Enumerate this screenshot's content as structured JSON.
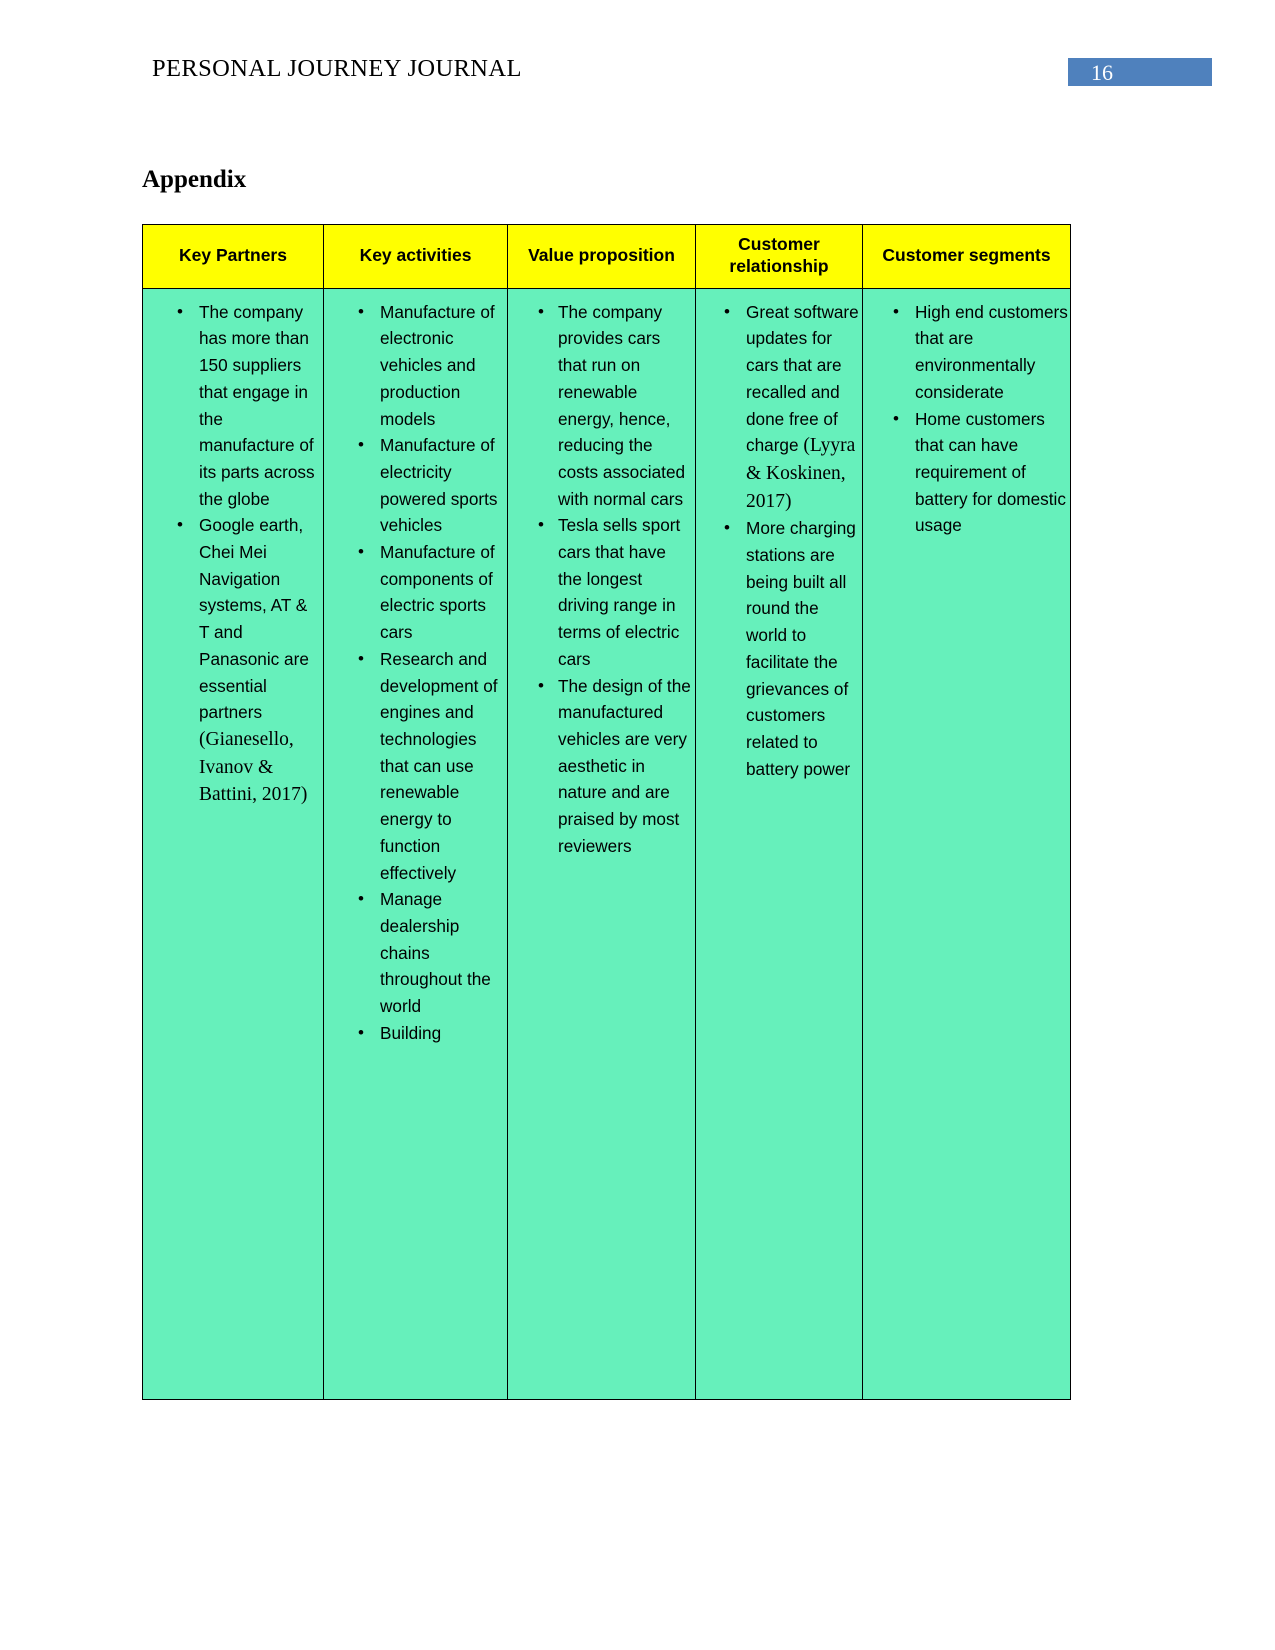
{
  "header": {
    "running_title": "PERSONAL JOURNEY JOURNAL",
    "page_number": "16",
    "badge_color": "#4f81bd"
  },
  "document": {
    "section_heading": "Appendix"
  },
  "table": {
    "header_background": "#ffff00",
    "cell_background": "#66f0bb",
    "columns": [
      {
        "id": "key-partners",
        "label": "Key Partners"
      },
      {
        "id": "key-activities",
        "label": "Key activities"
      },
      {
        "id": "value-proposition",
        "label": "Value proposition"
      },
      {
        "id": "customer-relationship",
        "label": "Customer relationship"
      },
      {
        "id": "customer-segments",
        "label": "Customer segments"
      }
    ],
    "cells": {
      "key_partners": {
        "item_0": "The company has more than 150 suppliers that engage in the manufacture of its parts across the globe",
        "item_1_main": "Google earth, Chei Mei Navigation systems, AT & T and Panasonic are essential partners ",
        "item_1_citation": "(Gianesello, Ivanov & Battini, 2017)"
      },
      "key_activities": {
        "item_0": "Manufacture of electronic vehicles and production models",
        "item_1": "Manufacture of electricity powered sports vehicles",
        "item_2": "Manufacture of components of electric sports cars",
        "item_3": "Research and development of engines and technologies that can use renewable energy to function effectively",
        "item_4": "Manage dealership chains throughout the world",
        "item_5": "Building"
      },
      "value_proposition": {
        "item_0": "The company provides cars that run on renewable energy, hence, reducing the costs associated with normal cars",
        "item_1": "Tesla sells sport cars that have the longest driving range in terms of electric cars",
        "item_2": "The design of the manufactured vehicles are very aesthetic in nature and are praised by most reviewers"
      },
      "customer_relationship": {
        "item_0_main": "Great software updates for cars that are recalled and done free of charge ",
        "item_0_citation": "(Lyyra & Koskinen, 2017)",
        "item_1": "More charging stations are being built all round the world to facilitate the grievances of customers related to battery power"
      },
      "customer_segments": {
        "item_0": "High end customers that are environmentally considerate",
        "item_1": "Home customers that can have requirement of battery for domestic usage"
      }
    }
  }
}
